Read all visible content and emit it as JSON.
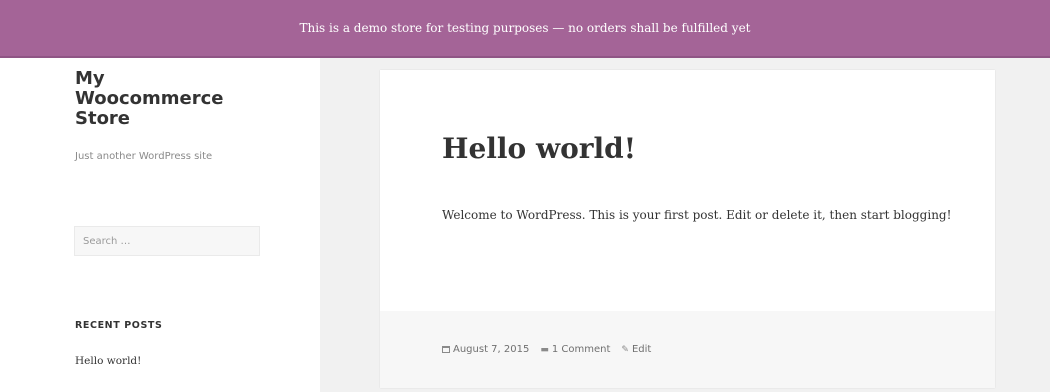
{
  "demo_notice": {
    "text": "This is a demo store for testing purposes — no orders shall be fulfilled yet"
  },
  "sidebar": {
    "site_title": "My Woocommerce Store",
    "site_description": "Just another WordPress site",
    "search": {
      "placeholder": "Search …",
      "value": ""
    },
    "recent_posts": {
      "title": "RECENT POSTS",
      "items": [
        "Hello world!"
      ]
    }
  },
  "post": {
    "title": "Hello world!",
    "content": "Welcome to WordPress. This is your first post. Edit or delete it, then start blogging!",
    "meta": {
      "date": "August 7, 2015",
      "comments": "1 Comment",
      "edit": "Edit"
    }
  },
  "icons": {
    "date": "calendar-icon",
    "comments": "comment-bubble-icon",
    "edit": "pencil-icon"
  },
  "colors": {
    "notice_bg": "#a46497",
    "page_bg": "#f1f1f1",
    "panel_bg": "#ffffff",
    "footer_bg": "#f7f7f7"
  }
}
